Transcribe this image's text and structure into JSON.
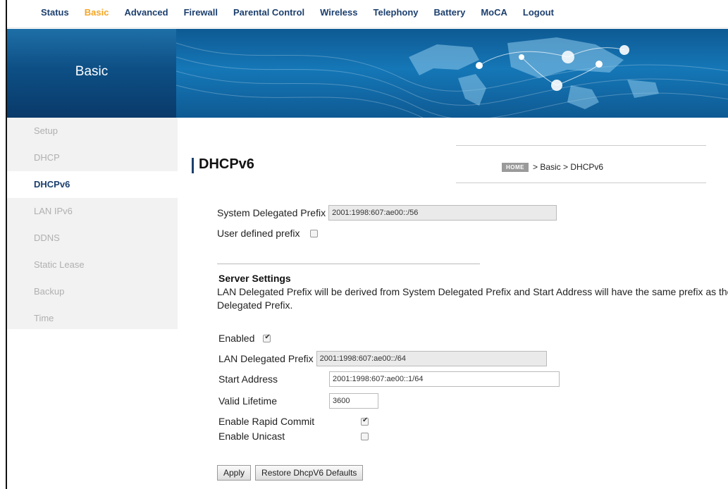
{
  "nav": {
    "items": [
      "Status",
      "Basic",
      "Advanced",
      "Firewall",
      "Parental Control",
      "Wireless",
      "Telephony",
      "Battery",
      "MoCA",
      "Logout"
    ],
    "active": "Basic"
  },
  "banner": {
    "title": "Basic"
  },
  "sidebar": {
    "items": [
      "Setup",
      "DHCP",
      "DHCPv6",
      "LAN IPv6",
      "DDNS",
      "Static Lease",
      "Backup",
      "Time"
    ],
    "active": "DHCPv6"
  },
  "page": {
    "title": "DHCPv6",
    "breadcrumb": {
      "home_badge": "HOME",
      "path": "> Basic > DHCPv6"
    }
  },
  "prefix": {
    "system_label": "System Delegated Prefix",
    "system_value": "2001:1998:607:ae00::/56",
    "user_defined_label": "User defined prefix",
    "user_defined_checked": false
  },
  "server": {
    "title": "Server Settings",
    "description": " LAN Delegated Prefix will be derived from System Delegated Prefix and Start Address will have the same prefix as the LAN Delegated Prefix.",
    "enabled_label": "Enabled",
    "enabled_checked": true,
    "lan_prefix_label": "LAN Delegated Prefix",
    "lan_prefix_value": "2001:1998:607:ae00::/64",
    "start_label": "Start Address",
    "start_value": "2001:1998:607:ae00::1/64",
    "lifetime_label": "Valid Lifetime",
    "lifetime_value": "3600",
    "rapid_label": "Enable Rapid Commit",
    "rapid_checked": true,
    "unicast_label": "Enable Unicast",
    "unicast_checked": false
  },
  "buttons": {
    "apply": "Apply",
    "restore": "Restore DhcpV6 Defaults"
  },
  "colors": {
    "nav_text": "#1c3f6e",
    "nav_active": "#f5a623",
    "banner_blue": "#0d4f85"
  }
}
